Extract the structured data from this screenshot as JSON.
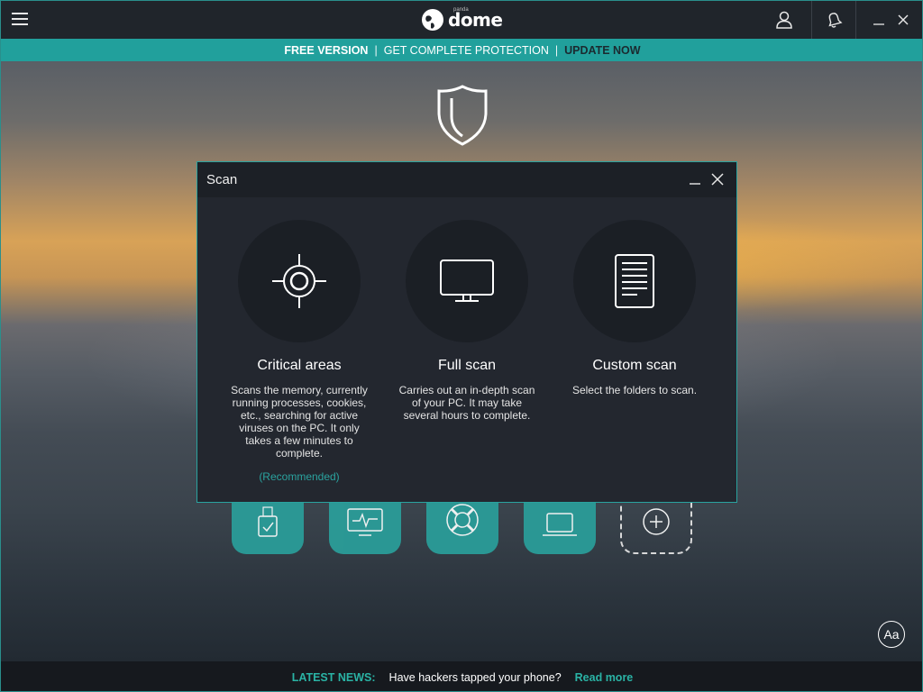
{
  "app": {
    "logo_text": "dome",
    "logo_small": "panda"
  },
  "promo": {
    "free_version": "FREE VERSION",
    "separator": "|",
    "get_protection": "GET COMPLETE PROTECTION",
    "update_now": "UPDATE NOW"
  },
  "dialog": {
    "title": "Scan",
    "options": [
      {
        "icon": "crosshair-icon",
        "title": "Critical areas",
        "description": "Scans the memory, currently running processes, cookies, etc., searching for active viruses on the PC. It only takes a few minutes to complete.",
        "note": "(Recommended)"
      },
      {
        "icon": "monitor-icon",
        "title": "Full scan",
        "description": "Carries out an in-depth scan of your PC. It may take several hours to complete."
      },
      {
        "icon": "document-icon",
        "title": "Custom scan",
        "description": "Select the folders to scan."
      }
    ]
  },
  "tiles": [
    "usb-icon",
    "monitor-pulse-icon",
    "lifebuoy-icon",
    "laptop-icon",
    "add-icon"
  ],
  "accessibility": {
    "font_button": "Aa"
  },
  "news": {
    "label": "LATEST NEWS:",
    "headline": "Have hackers tapped your phone?",
    "read_more": "Read more"
  },
  "colors": {
    "accent": "#21a09c",
    "titlebar": "#20252b",
    "dialog_bg": "#23272f",
    "news_accent": "#2ab3a5"
  }
}
